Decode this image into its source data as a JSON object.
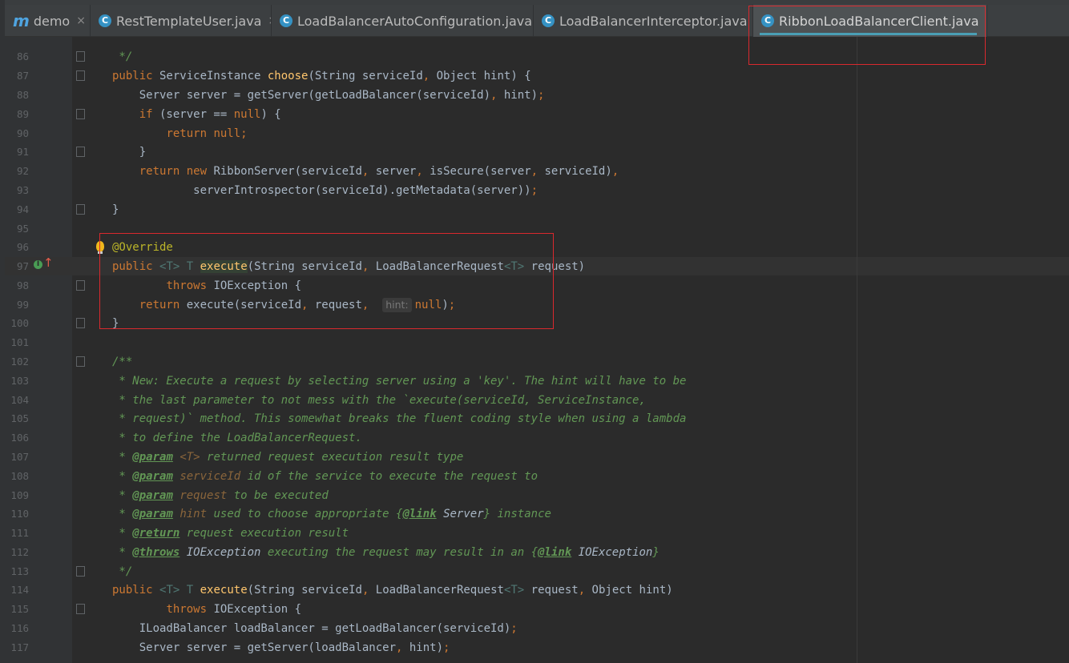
{
  "tabs": [
    {
      "icon": "m",
      "icon_name": "maven-module-icon",
      "label": "demo",
      "close": "×"
    },
    {
      "icon": "C",
      "icon_name": "java-class-icon",
      "label": "RestTemplateUser.java",
      "close": "×"
    },
    {
      "icon": "C",
      "icon_name": "java-class-icon",
      "label": "LoadBalancerAutoConfiguration.java",
      "close": "×"
    },
    {
      "icon": "C",
      "icon_name": "java-class-icon",
      "label": "LoadBalancerInterceptor.java",
      "close": "×"
    },
    {
      "icon": "C",
      "icon_name": "java-class-icon",
      "label": "RibbonLoadBalancerClient.java",
      "close": "×",
      "active": true
    }
  ],
  "editor": {
    "line_numbers": [
      "86",
      "87",
      "88",
      "89",
      "90",
      "91",
      "92",
      "93",
      "94",
      "95",
      "96",
      "97",
      "98",
      "99",
      "100",
      "101",
      "102",
      "103",
      "104",
      "105",
      "106",
      "107",
      "108",
      "109",
      "110",
      "111",
      "112",
      "113",
      "114",
      "115",
      "116",
      "117"
    ],
    "override_annotation": "@Override",
    "hint_label": "hint:",
    "colors": {
      "keyword": "#cc7832",
      "method": "#ffc66d",
      "comment": "#629755",
      "annotation": "#bbb529",
      "highlight_box": "#d9292e"
    }
  }
}
